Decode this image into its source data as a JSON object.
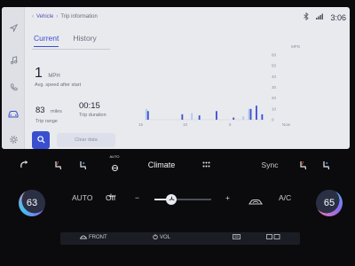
{
  "breadcrumb": {
    "root": "Vehicle",
    "current": "Trip information"
  },
  "status": {
    "clock": "3:06"
  },
  "tabs": [
    {
      "label": "Current",
      "active": true
    },
    {
      "label": "History",
      "active": false
    }
  ],
  "trip": {
    "speed_value": "1",
    "speed_unit": "MPH",
    "speed_label": "Avg. speed after start",
    "range_value": "83",
    "range_unit": "miles",
    "range_label": "Trip range",
    "duration_value": "00:15",
    "duration_label": "Trip duration"
  },
  "actions": {
    "clear_label": "Clear data"
  },
  "chart_data": {
    "type": "bar",
    "ylabel": "MPG",
    "ylim": [
      0,
      60
    ],
    "yticks": [
      "60",
      "50",
      "40",
      "30",
      "20",
      "10",
      "0"
    ],
    "xtick_labels": [
      "15",
      "10",
      "5",
      "Now"
    ],
    "values": [
      8,
      0,
      0,
      0,
      0,
      0,
      5,
      0,
      0,
      4,
      0,
      0,
      8,
      0,
      0,
      2,
      0,
      0,
      10,
      13,
      5
    ],
    "prev_values": [
      10,
      0,
      0,
      0,
      0,
      0,
      0,
      0,
      6,
      0,
      0,
      0,
      0,
      0,
      0,
      0,
      0,
      3,
      10,
      0,
      0
    ],
    "series_color": "#3a4fd0",
    "prev_color": "#a9c6ea"
  },
  "climate": {
    "title": "Climate",
    "auto_label": "AUTO",
    "auto_small_label": "AUTO",
    "off_label": "Off",
    "minus_label": "−",
    "plus_label": "+",
    "ac_label": "A/C",
    "sync_label": "Sync",
    "temp_left": "63",
    "temp_right": "65",
    "fan_level": 0.3,
    "front_label": "FRONT",
    "vol_label": "VOL"
  },
  "icons": {
    "navigation": "navigation-icon",
    "music": "music-icon",
    "phone": "phone-icon",
    "vehicle": "vehicle-icon",
    "settings": "settings-icon",
    "search": "search-icon",
    "bluetooth": "bluetooth-icon",
    "signal": "signal-icon",
    "menu": "grid-menu-icon",
    "recirculate": "recirculate-icon",
    "seat_heat": "seat-heat-icon",
    "steering_heat": "steering-heat-icon",
    "front_defrost": "front-defrost-icon",
    "rear_defrost": "rear-defrost-icon",
    "fan": "fan-icon"
  }
}
